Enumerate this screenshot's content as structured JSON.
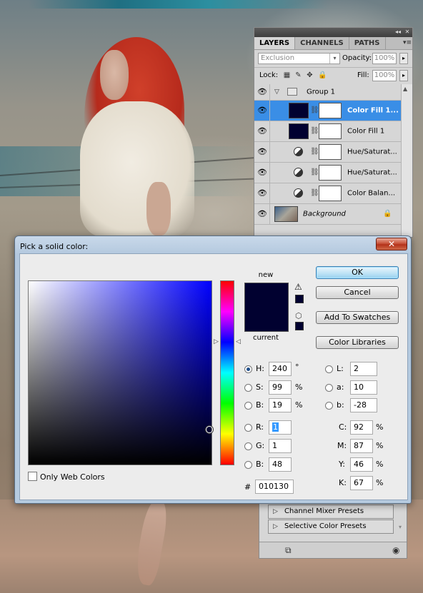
{
  "colors": {
    "current": "#010130",
    "new": "#010130",
    "selected_layer": "#3a8ee6",
    "dialog_title_bar": "#b3c8de"
  },
  "layers_panel": {
    "tabs": [
      "LAYERS",
      "CHANNELS",
      "PATHS"
    ],
    "blend_mode": "Exclusion",
    "opacity_label": "Opacity:",
    "opacity_value": "100%",
    "lock_label": "Lock:",
    "fill_label": "Fill:",
    "fill_value": "100%",
    "layers": [
      {
        "name": "Group 1",
        "type": "group",
        "visible": true
      },
      {
        "name": "Color Fill 1...",
        "type": "fill",
        "visible": true,
        "selected": true
      },
      {
        "name": "Color Fill 1",
        "type": "fill",
        "visible": true
      },
      {
        "name": "Hue/Saturat...",
        "type": "adjustment",
        "visible": true
      },
      {
        "name": "Hue/Saturat...",
        "type": "adjustment",
        "visible": true
      },
      {
        "name": "Color Balan...",
        "type": "adjustment",
        "visible": true
      },
      {
        "name": "Background",
        "type": "background",
        "visible": true,
        "locked": true
      }
    ]
  },
  "presets_panel": {
    "items": [
      "Channel Mixer Presets",
      "Selective Color Presets"
    ]
  },
  "dialog": {
    "title": "Pick a solid color:",
    "close_label": "✕",
    "label_new": "new",
    "label_current": "current",
    "buttons": {
      "ok": "OK",
      "cancel": "Cancel",
      "add_to_swatches": "Add To Swatches",
      "color_libraries": "Color Libraries"
    },
    "only_web_colors_label": "Only Web Colors",
    "only_web_colors_checked": false,
    "hsb": {
      "h_label": "H:",
      "h_value": "240",
      "h_unit": "°",
      "s_label": "S:",
      "s_value": "99",
      "s_unit": "%",
      "b_label": "B:",
      "b_value": "19",
      "b_unit": "%"
    },
    "rgb": {
      "r_label": "R:",
      "r_value": "1",
      "g_label": "G:",
      "g_value": "1",
      "b_label": "B:",
      "b_value": "48"
    },
    "hex_label": "#",
    "hex_value": "010130",
    "lab": {
      "l_label": "L:",
      "l_value": "2",
      "a_label": "a:",
      "a_value": "10",
      "b_label": "b:",
      "b_value": "-28"
    },
    "cmyk": {
      "c_label": "C:",
      "c_value": "92",
      "m_label": "M:",
      "m_value": "87",
      "y_label": "Y:",
      "y_value": "46",
      "k_label": "K:",
      "k_value": "67",
      "unit": "%"
    },
    "selected_mode": "H"
  }
}
